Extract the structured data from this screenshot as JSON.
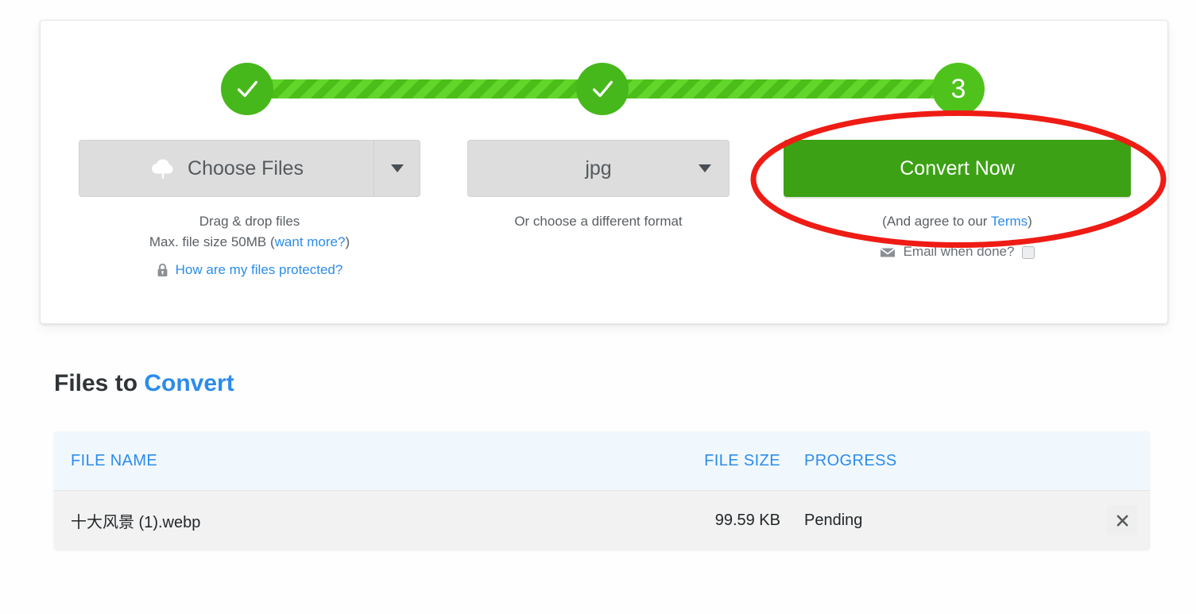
{
  "stepper": {
    "steps": [
      {
        "id": "step-1",
        "state": "done",
        "label": "✓"
      },
      {
        "id": "step-2",
        "state": "done",
        "label": "✓"
      },
      {
        "id": "step-3",
        "state": "current",
        "label": "3"
      }
    ]
  },
  "choose": {
    "button_label": "Choose Files",
    "icon": "cloud-upload-icon",
    "caret_icon": "chevron-down-icon",
    "drag_text": "Drag & drop files",
    "max_size_text": "Max. file size 50MB",
    "want_more_link": "want more?",
    "protected_link": "How are my files protected?",
    "lock_icon": "lock-icon"
  },
  "format": {
    "value": "jpg",
    "caption": "Or choose a different format",
    "caret_icon": "chevron-down-icon"
  },
  "convert": {
    "button_label": "Convert Now",
    "agree_prefix": "(And agree to our ",
    "terms_link": "Terms",
    "agree_suffix": ")",
    "email_label": "Email when done?",
    "email_icon": "envelope-icon",
    "email_checked": false
  },
  "annotation": {
    "shape": "ellipse-highlight",
    "color": "#ee1c14",
    "target": "convert-now-button"
  },
  "files_section": {
    "title_plain": "Files to ",
    "title_accent": "Convert",
    "columns": [
      "FILE NAME",
      "FILE SIZE",
      "PROGRESS"
    ],
    "rows": [
      {
        "name": "十大风景 (1).webp",
        "size": "99.59 KB",
        "progress": "Pending",
        "remove_icon": "close-icon"
      }
    ]
  },
  "colors": {
    "green_done": "#47b81b",
    "green_current": "#4fc31c",
    "green_button": "#3ca114",
    "blue_link": "#2b8cec",
    "annotation_red": "#ee1c14",
    "header_bg": "#f1f8fd",
    "row_bg": "#f2f2f2"
  }
}
